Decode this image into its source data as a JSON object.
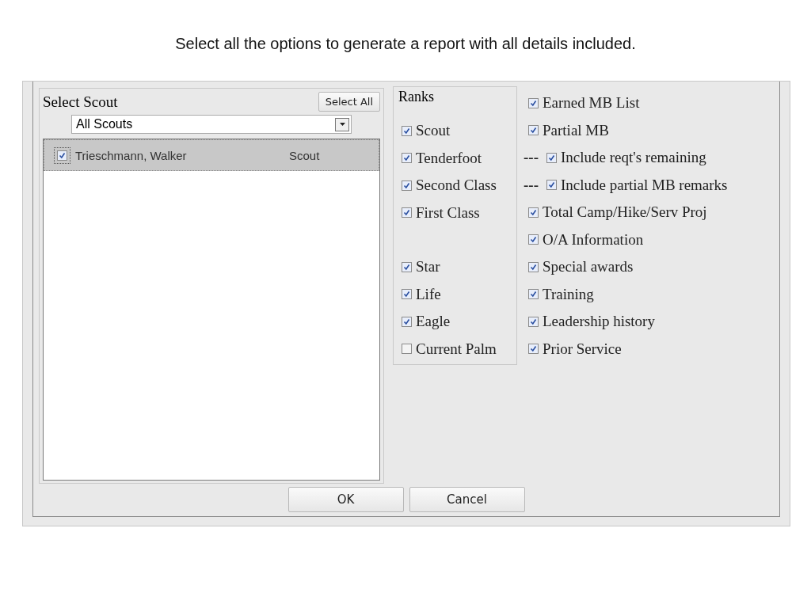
{
  "caption": "Select all the options to generate a report with all details included.",
  "scout_panel": {
    "title": "Select Scout",
    "select_all": "Select All",
    "filter": {
      "value": "All Scouts"
    },
    "rows": [
      {
        "name": "Trieschmann, Walker",
        "rank": "Scout",
        "checked": true,
        "selected": true
      }
    ]
  },
  "ranks": {
    "title": "Ranks",
    "groups": [
      {
        "items": [
          {
            "label": "Scout",
            "checked": true
          },
          {
            "label": "Tenderfoot",
            "checked": true
          },
          {
            "label": "Second Class",
            "checked": true
          },
          {
            "label": "First Class",
            "checked": true
          }
        ]
      },
      {
        "items": [
          {
            "label": "Star",
            "checked": true
          },
          {
            "label": "Life",
            "checked": true
          },
          {
            "label": "Eagle",
            "checked": true
          },
          {
            "label": "Current Palm",
            "checked": false
          }
        ]
      }
    ]
  },
  "options": [
    {
      "kind": "option",
      "label": "Earned MB List",
      "checked": true
    },
    {
      "kind": "option",
      "label": "Partial MB",
      "checked": true
    },
    {
      "kind": "sub",
      "prefix": "---",
      "label": "Include reqt's remaining",
      "checked": true
    },
    {
      "kind": "sub",
      "prefix": "---",
      "label": "Include partial MB remarks",
      "checked": true
    },
    {
      "kind": "option",
      "label": "Total Camp/Hike/Serv Proj",
      "checked": true
    },
    {
      "kind": "option",
      "label": "O/A Information",
      "checked": true
    },
    {
      "kind": "option",
      "label": "Special awards",
      "checked": true
    },
    {
      "kind": "option",
      "label": "Training",
      "checked": true
    },
    {
      "kind": "option",
      "label": "Leadership history",
      "checked": true
    },
    {
      "kind": "option",
      "label": "Prior Service",
      "checked": true
    }
  ],
  "buttons": [
    "OK",
    "Cancel"
  ]
}
